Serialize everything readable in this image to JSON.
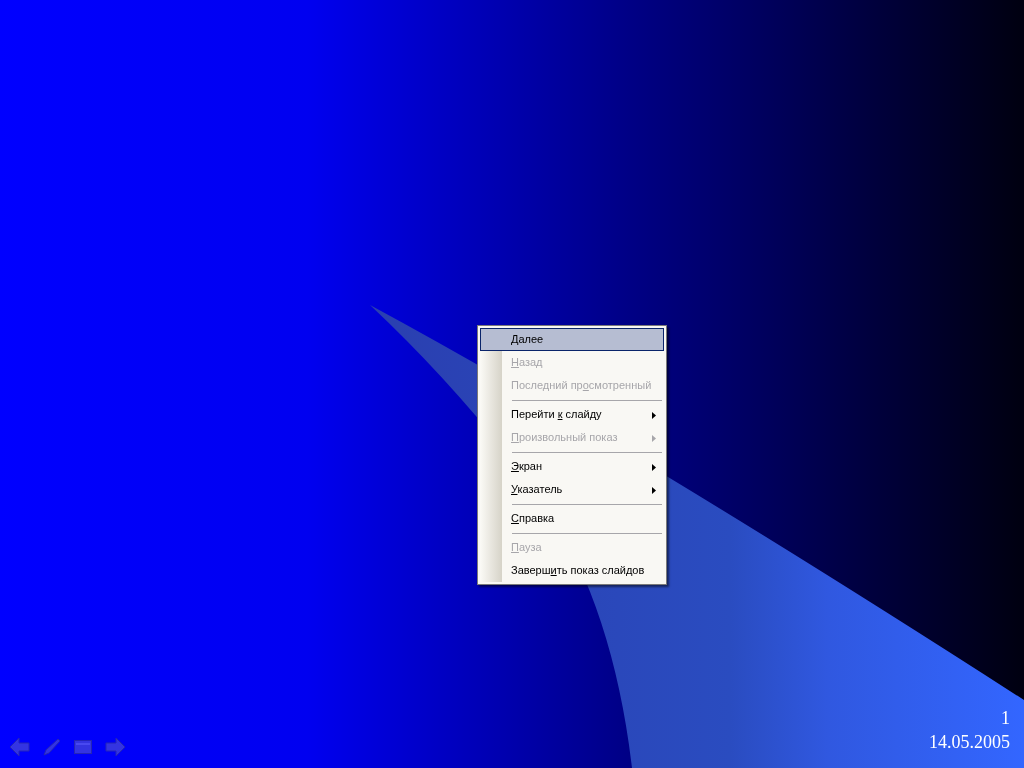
{
  "context_menu": {
    "items": [
      {
        "kind": "item",
        "label": {
          "key": "Д",
          "after": "алее"
        },
        "disabled": false,
        "selected": true,
        "submenu": false
      },
      {
        "kind": "item",
        "label": {
          "key": "Н",
          "after": "азад"
        },
        "disabled": true,
        "selected": false,
        "submenu": false
      },
      {
        "kind": "item",
        "label": {
          "before": "Последний пр",
          "key": "о",
          "after": "смотренный"
        },
        "disabled": true,
        "selected": false,
        "submenu": false
      },
      {
        "kind": "separator"
      },
      {
        "kind": "item",
        "label": {
          "before": "Перейти ",
          "key": "к",
          "after": " слайду"
        },
        "disabled": false,
        "selected": false,
        "submenu": true
      },
      {
        "kind": "item",
        "label": {
          "key": "П",
          "after": "роизвольный показ"
        },
        "disabled": true,
        "selected": false,
        "submenu": true
      },
      {
        "kind": "separator"
      },
      {
        "kind": "item",
        "label": {
          "key": "Э",
          "after": "кран"
        },
        "disabled": false,
        "selected": false,
        "submenu": true
      },
      {
        "kind": "item",
        "label": {
          "key": "У",
          "after": "казатель"
        },
        "disabled": false,
        "selected": false,
        "submenu": true
      },
      {
        "kind": "separator"
      },
      {
        "kind": "item",
        "label": {
          "key": "С",
          "after": "правка"
        },
        "disabled": false,
        "selected": false,
        "submenu": false
      },
      {
        "kind": "separator"
      },
      {
        "kind": "item",
        "label": {
          "key": "П",
          "after": "ауза"
        },
        "disabled": true,
        "selected": false,
        "submenu": false
      },
      {
        "kind": "item",
        "label": {
          "before": "Заверш",
          "key": "и",
          "after": "ть показ слайдов"
        },
        "disabled": false,
        "selected": false,
        "submenu": false
      }
    ]
  },
  "slide": {
    "number": "1",
    "date": "14.05.2005"
  }
}
